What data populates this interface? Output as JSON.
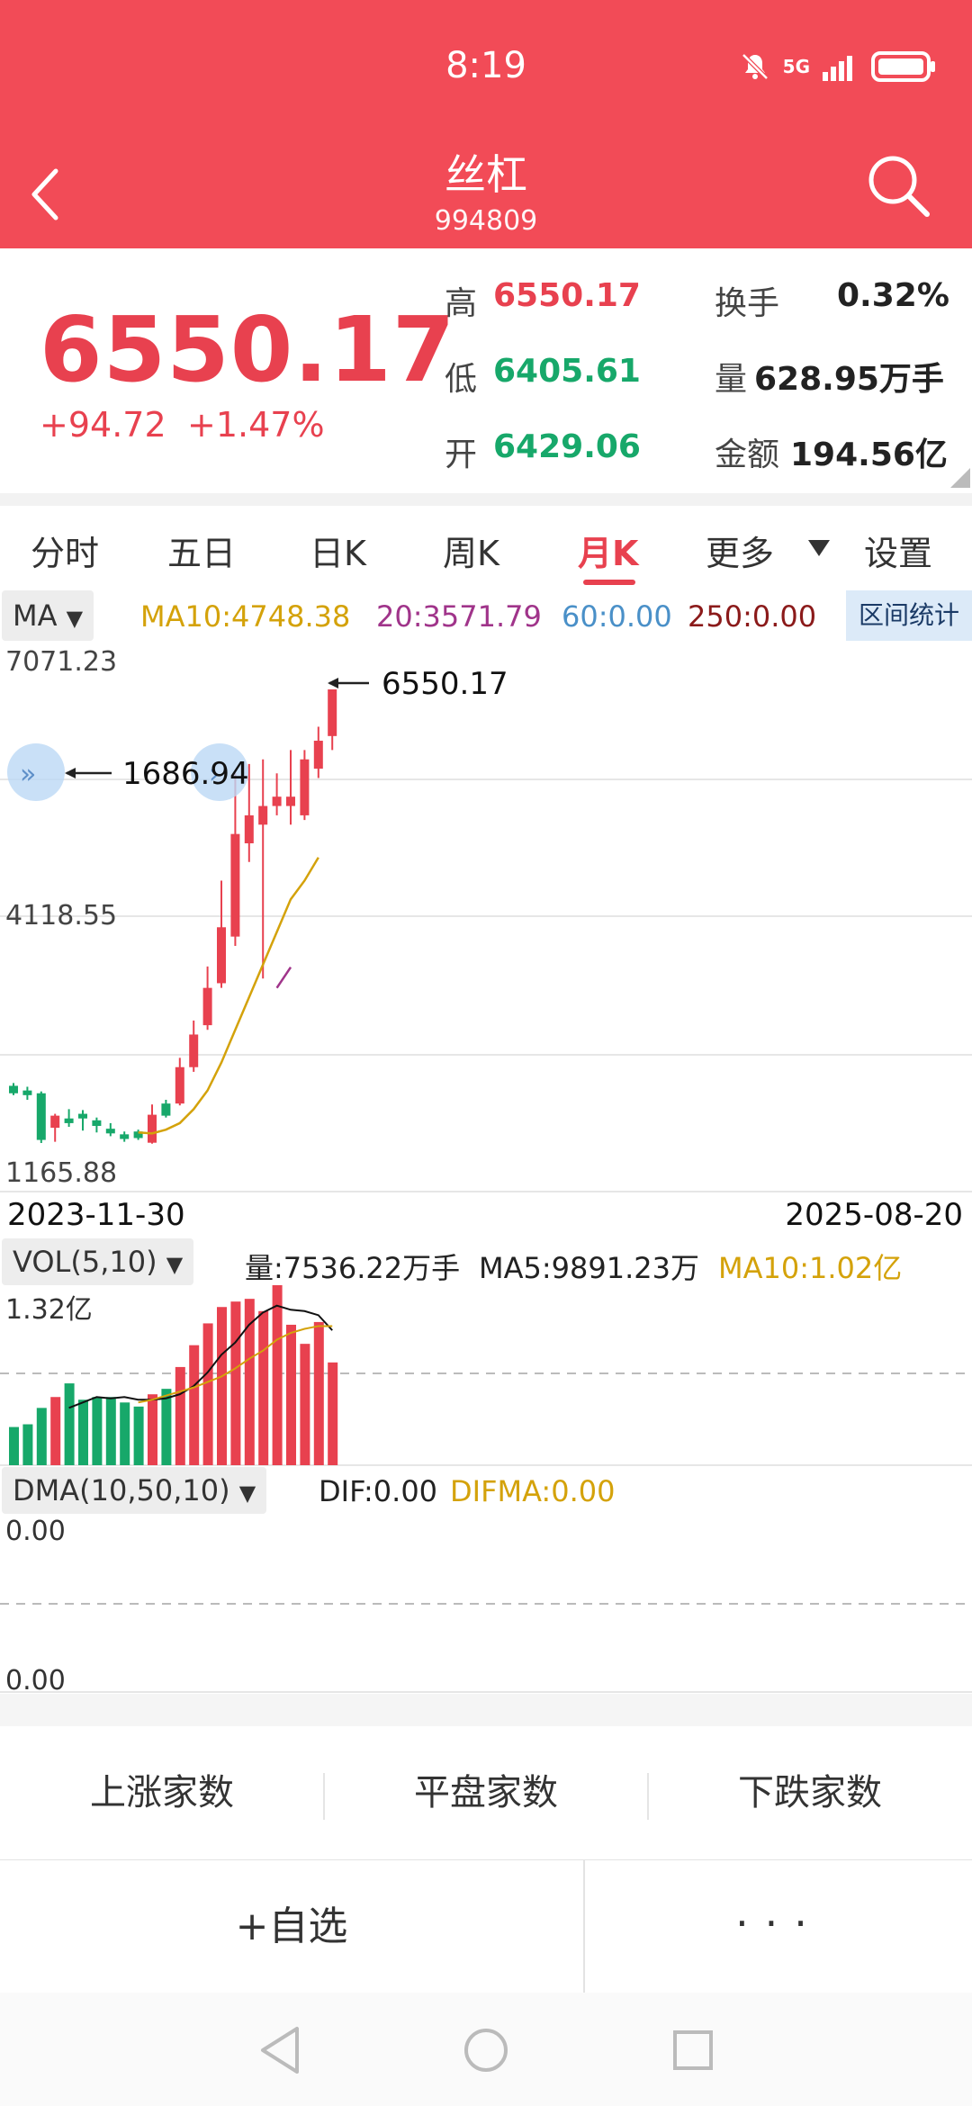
{
  "status_bar": {
    "time": "8:19",
    "network": "5G"
  },
  "header": {
    "title": "丝杠",
    "code": "994809"
  },
  "quote": {
    "price": "6550.17",
    "change": "+94.72",
    "change_pct": "+1.47%",
    "high_label": "高",
    "high": "6550.17",
    "low_label": "低",
    "low": "6405.61",
    "open_label": "开",
    "open": "6429.06",
    "turnover_label": "换手",
    "turnover": "0.32%",
    "volume_label": "量",
    "volume": "628.95万手",
    "amount_label": "金额",
    "amount": "194.56亿"
  },
  "tabs": [
    "分时",
    "五日",
    "日K",
    "周K",
    "月K",
    "更多",
    "设置"
  ],
  "active_tab": "月K",
  "indicator": {
    "ma_chip": "MA",
    "ma10": "MA10:4748.38",
    "ma20": "20:3571.79",
    "ma60": "60:0.00",
    "ma250": "250:0.00",
    "range_stat": "区间统计"
  },
  "axis": {
    "top": "7071.23",
    "mid": "4118.55",
    "bottom": "1165.88",
    "max_annot": "6550.17",
    "min_annot": "1686.94",
    "start_date": "2023-11-30",
    "end_date": "2025-08-20"
  },
  "volume": {
    "chip": "VOL(5,10)",
    "vol": "量:7536.22万手",
    "ma5": "MA5:9891.23万",
    "ma10": "MA10:1.02亿",
    "top_label": "1.32亿"
  },
  "dma": {
    "chip": "DMA(10,50,10)",
    "dif": "DIF:0.00",
    "difma": "DIFMA:0.00",
    "top_label": "0.00",
    "bottom_label": "0.00"
  },
  "stats": [
    "上涨家数",
    "平盘家数",
    "下跌家数"
  ],
  "actions": {
    "add_watch": "+自选",
    "more": "···"
  },
  "colors": {
    "header": "#f24b57",
    "up": "#e8414f",
    "down": "#17a86a",
    "ma10": "#d4a20a",
    "ma20": "#a0348a"
  },
  "chart_data": {
    "type": "candlestick",
    "ylim": [
      1165.88,
      7071.23
    ],
    "candles": [
      {
        "o": 2300,
        "c": 2220,
        "h": 2330,
        "l": 2200
      },
      {
        "o": 2250,
        "c": 2200,
        "h": 2290,
        "l": 2150
      },
      {
        "o": 2220,
        "c": 1720,
        "h": 2240,
        "l": 1686.94
      },
      {
        "o": 1850,
        "c": 1980,
        "h": 2000,
        "l": 1700
      },
      {
        "o": 1950,
        "c": 1900,
        "h": 2050,
        "l": 1860
      },
      {
        "o": 2000,
        "c": 1950,
        "h": 2040,
        "l": 1820
      },
      {
        "o": 1930,
        "c": 1870,
        "h": 1960,
        "l": 1800
      },
      {
        "o": 1840,
        "c": 1790,
        "h": 1900,
        "l": 1760
      },
      {
        "o": 1780,
        "c": 1730,
        "h": 1810,
        "l": 1700
      },
      {
        "o": 1810,
        "c": 1740,
        "h": 1830,
        "l": 1720
      },
      {
        "o": 1690,
        "c": 1990,
        "h": 2100,
        "l": 1680
      },
      {
        "o": 2110,
        "c": 1980,
        "h": 2150,
        "l": 1960
      },
      {
        "o": 2110,
        "c": 2500,
        "h": 2600,
        "l": 2090
      },
      {
        "o": 2500,
        "c": 2850,
        "h": 3000,
        "l": 2450
      },
      {
        "o": 2950,
        "c": 3350,
        "h": 3580,
        "l": 2900
      },
      {
        "o": 3400,
        "c": 4000,
        "h": 4500,
        "l": 3350
      },
      {
        "o": 3900,
        "c": 5000,
        "h": 5650,
        "l": 3800
      },
      {
        "o": 4900,
        "c": 5200,
        "h": 5750,
        "l": 4700
      },
      {
        "o": 5100,
        "c": 5300,
        "h": 5800,
        "l": 3450
      },
      {
        "o": 5300,
        "c": 5400,
        "h": 5650,
        "l": 5200
      },
      {
        "o": 5300,
        "c": 5400,
        "h": 5900,
        "l": 5100
      },
      {
        "o": 5200,
        "c": 5800,
        "h": 5900,
        "l": 5150
      },
      {
        "o": 5700,
        "c": 6000,
        "h": 6150,
        "l": 5600
      },
      {
        "o": 6050,
        "c": 6550.17,
        "h": 6550.17,
        "l": 5900
      }
    ],
    "ma10_start_index": 9,
    "ma10": [
      1800,
      1790,
      1830,
      1900,
      2050,
      2250,
      2550,
      2900,
      3250,
      3600,
      3950,
      4300,
      4500,
      4748.38
    ],
    "ma20_start_index": 19,
    "ma20": [
      3350,
      3571.79
    ],
    "volume_ylim": [
      0,
      13200
    ],
    "volume": [
      2800,
      3000,
      4200,
      5000,
      6000,
      4800,
      5000,
      5000,
      4600,
      4300,
      5200,
      5600,
      7200,
      8800,
      10400,
      11600,
      12000,
      12200,
      11300,
      13200,
      10300,
      8900,
      10500,
      7536.22
    ],
    "vol_ma5": [
      null,
      null,
      null,
      null,
      4200,
      4600,
      5000,
      4900,
      5000,
      4800,
      4800,
      4900,
      5200,
      5800,
      6800,
      8100,
      9000,
      10300,
      11200,
      11700,
      11400,
      11300,
      11000,
      9891.23
    ],
    "vol_ma10": [
      null,
      null,
      null,
      null,
      null,
      null,
      null,
      null,
      null,
      4600,
      4800,
      5100,
      5400,
      5700,
      6100,
      6500,
      7100,
      7800,
      8400,
      9200,
      9700,
      10000,
      10200,
      10200
    ],
    "dma": {
      "dif": 0.0,
      "difma": 0.0
    }
  }
}
